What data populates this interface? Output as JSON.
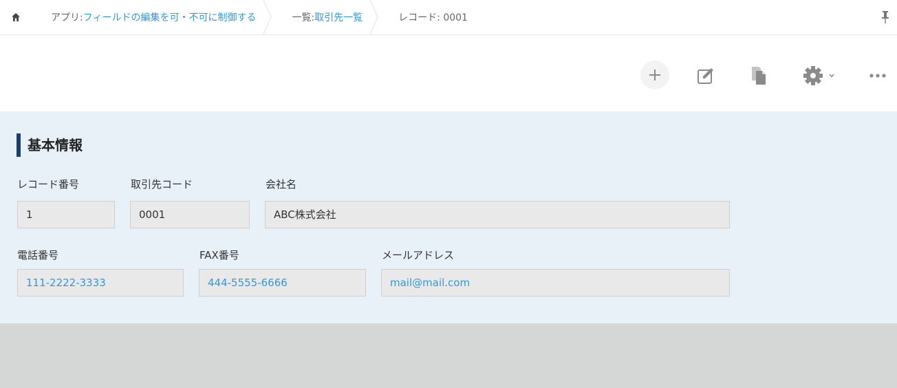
{
  "breadcrumb": {
    "app_prefix": "アプリ: ",
    "app_name": "フィールドの編集を可・不可に制御する",
    "list_prefix": "一覧: ",
    "list_name": "取引先一覧",
    "record": "レコード: 0001"
  },
  "icons": {
    "home": "home-icon",
    "pin": "pin-icon",
    "add": "plus-icon",
    "edit": "edit-icon",
    "copy": "copy-icon",
    "settings": "gear-icon",
    "more": "more-icon"
  },
  "colors": {
    "link": "#3498db",
    "section_bar": "#1f3f6b",
    "form_bg": "#e8f0f8"
  },
  "section": {
    "title": "基本情報"
  },
  "fields": {
    "record_no": {
      "label": "レコード番号",
      "value": "1"
    },
    "client_code": {
      "label": "取引先コード",
      "value": "0001"
    },
    "company": {
      "label": "会社名",
      "value": "ABC株式会社"
    },
    "phone": {
      "label": "電話番号",
      "value": "111-2222-3333"
    },
    "fax": {
      "label": "FAX番号",
      "value": "444-5555-6666"
    },
    "email": {
      "label": "メールアドレス",
      "value": "mail@mail.com"
    }
  }
}
